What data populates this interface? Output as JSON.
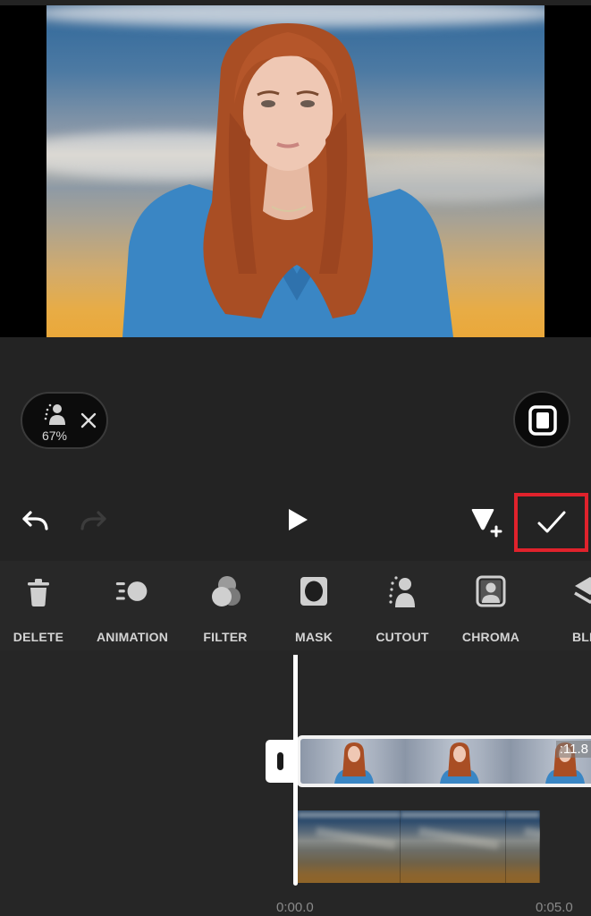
{
  "preview": {
    "subject": "woman with long red hair in blue jacket",
    "background": "sky-gradient"
  },
  "cutout_chip": {
    "icon": "cutout-person-icon",
    "value": "67%",
    "close_icon": "close-icon"
  },
  "aspect_button": {
    "icon": "aspect-ratio-icon"
  },
  "playback": {
    "undo_icon": "undo-icon",
    "redo_icon": "redo-icon",
    "redo_enabled": false,
    "play_icon": "play-icon",
    "keyframe_icon": "keyframe-add-icon",
    "confirm_icon": "checkmark-icon",
    "highlight_color": "#e0222c"
  },
  "toolbar": {
    "items": [
      {
        "label": "DELETE",
        "icon": "trash-icon"
      },
      {
        "label": "ANIMATION",
        "icon": "animation-icon"
      },
      {
        "label": "FILTER",
        "icon": "filter-icon"
      },
      {
        "label": "MASK",
        "icon": "mask-icon"
      },
      {
        "label": "CUTOUT",
        "icon": "cutout-icon"
      },
      {
        "label": "CHROMA",
        "icon": "chroma-icon"
      },
      {
        "label": "BLEN",
        "icon": "blend-layers-icon"
      }
    ]
  },
  "timeline": {
    "overlay_clip_duration": ":11.8",
    "time_start": "0:00.0",
    "time_end": "0:05.0"
  }
}
